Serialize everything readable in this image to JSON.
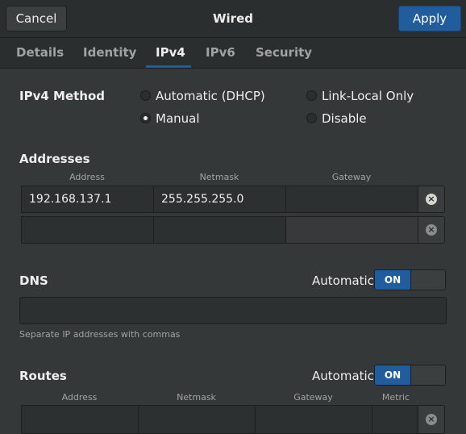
{
  "header": {
    "cancel_label": "Cancel",
    "title": "Wired",
    "apply_label": "Apply"
  },
  "tabs": [
    {
      "label": "Details"
    },
    {
      "label": "Identity"
    },
    {
      "label": "IPv4"
    },
    {
      "label": "IPv6"
    },
    {
      "label": "Security"
    }
  ],
  "active_tab": "IPv4",
  "ipv4_method": {
    "label": "IPv4 Method",
    "options": [
      {
        "label": "Automatic (DHCP)",
        "checked": false
      },
      {
        "label": "Link-Local Only",
        "checked": false
      },
      {
        "label": "Manual",
        "checked": true
      },
      {
        "label": "Disable",
        "checked": false
      }
    ]
  },
  "addresses": {
    "title": "Addresses",
    "columns": [
      "Address",
      "Netmask",
      "Gateway"
    ],
    "rows": [
      {
        "address": "192.168.137.1",
        "netmask": "255.255.255.0",
        "gateway": ""
      },
      {
        "address": "",
        "netmask": "",
        "gateway": ""
      }
    ]
  },
  "dns": {
    "title": "DNS",
    "automatic_label": "Automatic",
    "switch_label": "ON",
    "value": "",
    "hint": "Separate IP addresses with commas"
  },
  "routes": {
    "title": "Routes",
    "automatic_label": "Automatic",
    "switch_label": "ON",
    "columns": [
      "Address",
      "Netmask",
      "Gateway",
      "Metric"
    ]
  },
  "colors": {
    "accent": "#215d9c",
    "background": "#353839",
    "header": "#2b2e2f"
  }
}
